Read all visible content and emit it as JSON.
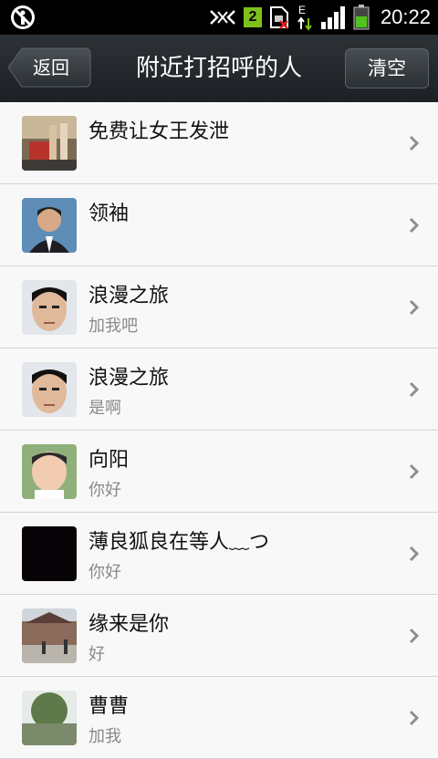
{
  "statusbar": {
    "sim_number": "2",
    "network_type": "E",
    "time": "20:22",
    "icons": [
      "no-entry-icon",
      "usb-debug-icon",
      "sim-icon",
      "sim-missing-icon",
      "data-arrows-icon",
      "signal-icon",
      "battery-icon"
    ]
  },
  "titlebar": {
    "back_label": "返回",
    "title": "附近打招呼的人",
    "clear_label": "清空"
  },
  "list": {
    "items": [
      {
        "name": "免费让女王发泄",
        "message": ""
      },
      {
        "name": "领袖",
        "message": ""
      },
      {
        "name": "浪漫之旅",
        "message": "加我吧"
      },
      {
        "name": "浪漫之旅",
        "message": "是啊"
      },
      {
        "name": "向阳",
        "message": "你好"
      },
      {
        "name": "薄良狐良在等人﹏つ",
        "message": "你好"
      },
      {
        "name": "缘来是你",
        "message": "好"
      },
      {
        "name": "曹曹",
        "message": "加我"
      }
    ]
  },
  "colors": {
    "titlebar_bg": "#23282c",
    "list_bg": "#f8f8f8",
    "divider": "#d4d4d4",
    "sim_badge": "#7fbf1a",
    "battery_fill": "#4fc21b"
  }
}
